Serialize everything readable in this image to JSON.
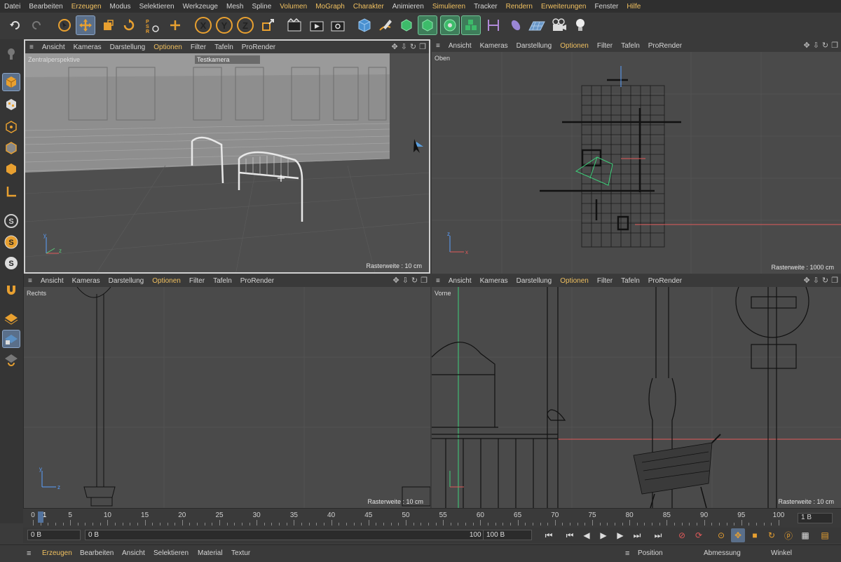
{
  "menubar": [
    {
      "label": "Datei",
      "hl": false
    },
    {
      "label": "Bearbeiten",
      "hl": false
    },
    {
      "label": "Erzeugen",
      "hl": true
    },
    {
      "label": "Modus",
      "hl": false
    },
    {
      "label": "Selektieren",
      "hl": false
    },
    {
      "label": "Werkzeuge",
      "hl": false
    },
    {
      "label": "Mesh",
      "hl": false
    },
    {
      "label": "Spline",
      "hl": false
    },
    {
      "label": "Volumen",
      "hl": true
    },
    {
      "label": "MoGraph",
      "hl": true
    },
    {
      "label": "Charakter",
      "hl": true
    },
    {
      "label": "Animieren",
      "hl": false
    },
    {
      "label": "Simulieren",
      "hl": true
    },
    {
      "label": "Tracker",
      "hl": false
    },
    {
      "label": "Rendern",
      "hl": true
    },
    {
      "label": "Erweiterungen",
      "hl": true
    },
    {
      "label": "Fenster",
      "hl": false
    },
    {
      "label": "Hilfe",
      "hl": true
    }
  ],
  "toolbar": {
    "axis_x": "X",
    "axis_y": "Y",
    "axis_z": "Z",
    "icons": [
      "undo-icon",
      "redo-icon",
      "select-icon",
      "move-icon",
      "scale-icon",
      "rotate-icon",
      "psr-icon",
      "add-icon",
      "axis-x-icon",
      "axis-y-icon",
      "axis-z-icon",
      "coordinate-system-icon",
      "render-view-icon",
      "render-picture-queue-icon",
      "render-settings-icon",
      "cube-icon",
      "pen-icon",
      "subdivision-icon",
      "extrude-icon",
      "cloner-icon",
      "mograph-icon",
      "spline-mask-icon",
      "deformer-icon",
      "floor-icon",
      "camera-icon",
      "light-icon"
    ]
  },
  "leftbar": {
    "icons": [
      "make-editable-icon",
      "model-mode-icon",
      "texture-mode-icon",
      "point-mode-icon",
      "edge-mode-icon",
      "polygon-mode-icon",
      "axis-mode-icon",
      "snap-icon",
      "snap-settings-icon",
      "workplane-icon",
      "magnet-icon",
      "solo-icon",
      "locked-workplane-icon",
      "timeline-icon"
    ],
    "s_label": "S",
    "l_label": "L"
  },
  "viewport_menu": [
    "Ansicht",
    "Kameras",
    "Darstellung",
    "Optionen",
    "Filter",
    "Tafeln",
    "ProRender"
  ],
  "viewports": {
    "tl": {
      "label": "Zentralperspektive",
      "camera": "Testkamera",
      "raster": "Rasterweite : 10 cm"
    },
    "tr": {
      "label": "Oben",
      "raster": "Rasterweite : 1000 cm"
    },
    "bl": {
      "label": "Rechts",
      "raster": "Rasterweite : 10 cm"
    },
    "br": {
      "label": "Vorne",
      "raster": "Rasterweite : 10 cm"
    }
  },
  "axis_labels": {
    "x": "x",
    "y": "y",
    "z": "z"
  },
  "timeline": {
    "ticks": [
      "0",
      "5",
      "10",
      "15",
      "20",
      "25",
      "30",
      "35",
      "40",
      "45",
      "50",
      "55",
      "60",
      "65",
      "70",
      "75",
      "80",
      "85",
      "90",
      "95",
      "100"
    ],
    "current_frame": "1",
    "frame_field": "1 B"
  },
  "transport": {
    "start": "0 B",
    "range_start": "0 B",
    "range_end": "100 B",
    "end": "100 B"
  },
  "bottombar": {
    "left": [
      "Erzeugen",
      "Bearbeiten",
      "Ansicht",
      "Selektieren",
      "Material",
      "Textur"
    ],
    "right": [
      "Position",
      "Abmessung",
      "Winkel"
    ]
  },
  "colors": {
    "accent": "#f0c060",
    "selection": "#5a6f8a",
    "green": "#3e7d5a"
  }
}
